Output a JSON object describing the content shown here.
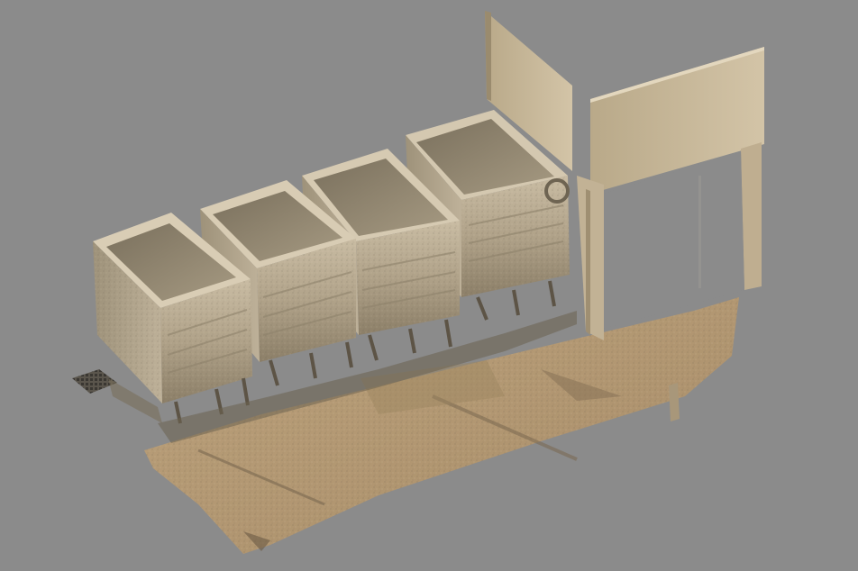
{
  "viewport": {
    "background_color": "#8b8b8b"
  },
  "scan": {
    "subject": "point-cloud-scan",
    "colors": {
      "floor": "#b39a76",
      "floor_shadow": "#8e7a5c",
      "wall": "#c8b89c",
      "wall_shade": "#a8977a",
      "bin_light": "#c8bba2",
      "bin_mid": "#a79a82",
      "bin_dark": "#6f6553",
      "grate": "#4e4a44"
    },
    "bin_count": 4
  }
}
